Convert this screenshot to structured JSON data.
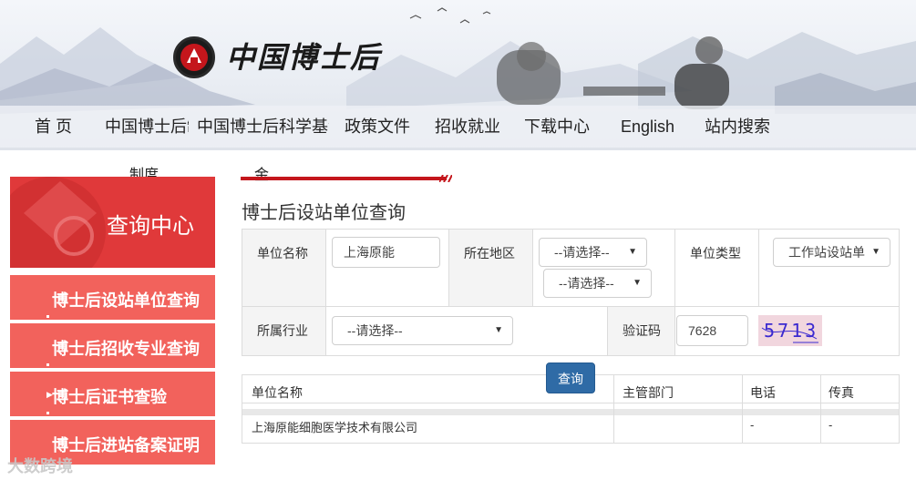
{
  "header": {
    "site_name": "中国博士后",
    "nav": [
      {
        "label": "首 页"
      },
      {
        "label": "中国博士后制度"
      },
      {
        "label": "中国博士后科学基金"
      },
      {
        "label": "政策文件"
      },
      {
        "label": "招收就业"
      },
      {
        "label": "下载中心"
      },
      {
        "label": "English"
      },
      {
        "label": "站内搜索"
      }
    ],
    "nav_wrap_1": "制度",
    "nav_wrap_2": "金"
  },
  "sidebar": {
    "title": "查询中心",
    "items": [
      {
        "label": "博士后设站单位查询"
      },
      {
        "label": "博士后招收专业查询"
      },
      {
        "label": "博士后证书查验"
      },
      {
        "label": "博士后进站备案证明"
      }
    ]
  },
  "main": {
    "title": "博士后设站单位查询",
    "form": {
      "unit_name_label": "单位名称",
      "unit_name_value": "上海原能",
      "region_label": "所在地区",
      "region_select_1": "--请选择--",
      "region_select_2": "--请选择--",
      "unit_type_label": "单位类型",
      "unit_type_value": "工作站设站单",
      "industry_label": "所属行业",
      "industry_value": "--请选择--",
      "captcha_label": "验证码",
      "captcha_input": "7628",
      "captcha_image_text": "5713"
    },
    "query_button": "查询",
    "results": {
      "columns": [
        "单位名称",
        "主管部门",
        "电话",
        "传真"
      ],
      "rows": [
        [
          "上海原能细胞医学技术有限公司",
          "",
          "-",
          "-"
        ]
      ]
    }
  },
  "watermark": "大数跨境",
  "colors": {
    "brand_red": "#e0393a",
    "sidebar_item": "#f2625c",
    "button_blue": "#2f6ba6"
  }
}
